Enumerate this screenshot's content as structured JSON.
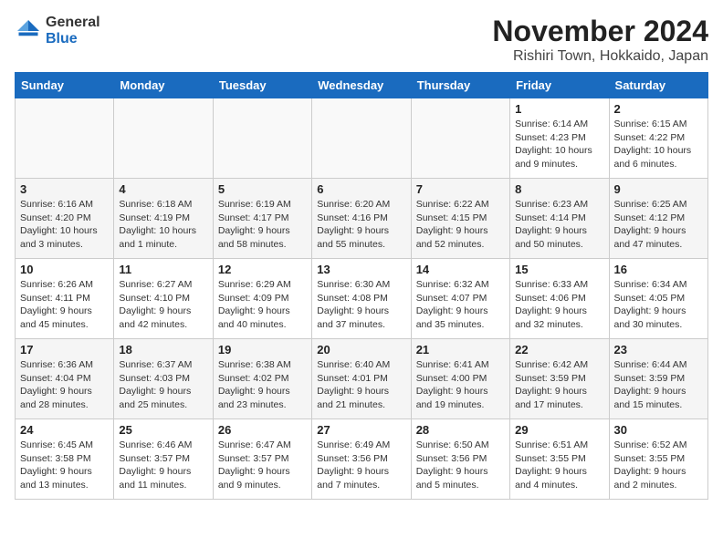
{
  "logo": {
    "general": "General",
    "blue": "Blue"
  },
  "header": {
    "month": "November 2024",
    "location": "Rishiri Town, Hokkaido, Japan"
  },
  "weekdays": [
    "Sunday",
    "Monday",
    "Tuesday",
    "Wednesday",
    "Thursday",
    "Friday",
    "Saturday"
  ],
  "weeks": [
    [
      {
        "day": "",
        "info": ""
      },
      {
        "day": "",
        "info": ""
      },
      {
        "day": "",
        "info": ""
      },
      {
        "day": "",
        "info": ""
      },
      {
        "day": "",
        "info": ""
      },
      {
        "day": "1",
        "info": "Sunrise: 6:14 AM\nSunset: 4:23 PM\nDaylight: 10 hours\nand 9 minutes."
      },
      {
        "day": "2",
        "info": "Sunrise: 6:15 AM\nSunset: 4:22 PM\nDaylight: 10 hours\nand 6 minutes."
      }
    ],
    [
      {
        "day": "3",
        "info": "Sunrise: 6:16 AM\nSunset: 4:20 PM\nDaylight: 10 hours\nand 3 minutes."
      },
      {
        "day": "4",
        "info": "Sunrise: 6:18 AM\nSunset: 4:19 PM\nDaylight: 10 hours\nand 1 minute."
      },
      {
        "day": "5",
        "info": "Sunrise: 6:19 AM\nSunset: 4:17 PM\nDaylight: 9 hours\nand 58 minutes."
      },
      {
        "day": "6",
        "info": "Sunrise: 6:20 AM\nSunset: 4:16 PM\nDaylight: 9 hours\nand 55 minutes."
      },
      {
        "day": "7",
        "info": "Sunrise: 6:22 AM\nSunset: 4:15 PM\nDaylight: 9 hours\nand 52 minutes."
      },
      {
        "day": "8",
        "info": "Sunrise: 6:23 AM\nSunset: 4:14 PM\nDaylight: 9 hours\nand 50 minutes."
      },
      {
        "day": "9",
        "info": "Sunrise: 6:25 AM\nSunset: 4:12 PM\nDaylight: 9 hours\nand 47 minutes."
      }
    ],
    [
      {
        "day": "10",
        "info": "Sunrise: 6:26 AM\nSunset: 4:11 PM\nDaylight: 9 hours\nand 45 minutes."
      },
      {
        "day": "11",
        "info": "Sunrise: 6:27 AM\nSunset: 4:10 PM\nDaylight: 9 hours\nand 42 minutes."
      },
      {
        "day": "12",
        "info": "Sunrise: 6:29 AM\nSunset: 4:09 PM\nDaylight: 9 hours\nand 40 minutes."
      },
      {
        "day": "13",
        "info": "Sunrise: 6:30 AM\nSunset: 4:08 PM\nDaylight: 9 hours\nand 37 minutes."
      },
      {
        "day": "14",
        "info": "Sunrise: 6:32 AM\nSunset: 4:07 PM\nDaylight: 9 hours\nand 35 minutes."
      },
      {
        "day": "15",
        "info": "Sunrise: 6:33 AM\nSunset: 4:06 PM\nDaylight: 9 hours\nand 32 minutes."
      },
      {
        "day": "16",
        "info": "Sunrise: 6:34 AM\nSunset: 4:05 PM\nDaylight: 9 hours\nand 30 minutes."
      }
    ],
    [
      {
        "day": "17",
        "info": "Sunrise: 6:36 AM\nSunset: 4:04 PM\nDaylight: 9 hours\nand 28 minutes."
      },
      {
        "day": "18",
        "info": "Sunrise: 6:37 AM\nSunset: 4:03 PM\nDaylight: 9 hours\nand 25 minutes."
      },
      {
        "day": "19",
        "info": "Sunrise: 6:38 AM\nSunset: 4:02 PM\nDaylight: 9 hours\nand 23 minutes."
      },
      {
        "day": "20",
        "info": "Sunrise: 6:40 AM\nSunset: 4:01 PM\nDaylight: 9 hours\nand 21 minutes."
      },
      {
        "day": "21",
        "info": "Sunrise: 6:41 AM\nSunset: 4:00 PM\nDaylight: 9 hours\nand 19 minutes."
      },
      {
        "day": "22",
        "info": "Sunrise: 6:42 AM\nSunset: 3:59 PM\nDaylight: 9 hours\nand 17 minutes."
      },
      {
        "day": "23",
        "info": "Sunrise: 6:44 AM\nSunset: 3:59 PM\nDaylight: 9 hours\nand 15 minutes."
      }
    ],
    [
      {
        "day": "24",
        "info": "Sunrise: 6:45 AM\nSunset: 3:58 PM\nDaylight: 9 hours\nand 13 minutes."
      },
      {
        "day": "25",
        "info": "Sunrise: 6:46 AM\nSunset: 3:57 PM\nDaylight: 9 hours\nand 11 minutes."
      },
      {
        "day": "26",
        "info": "Sunrise: 6:47 AM\nSunset: 3:57 PM\nDaylight: 9 hours\nand 9 minutes."
      },
      {
        "day": "27",
        "info": "Sunrise: 6:49 AM\nSunset: 3:56 PM\nDaylight: 9 hours\nand 7 minutes."
      },
      {
        "day": "28",
        "info": "Sunrise: 6:50 AM\nSunset: 3:56 PM\nDaylight: 9 hours\nand 5 minutes."
      },
      {
        "day": "29",
        "info": "Sunrise: 6:51 AM\nSunset: 3:55 PM\nDaylight: 9 hours\nand 4 minutes."
      },
      {
        "day": "30",
        "info": "Sunrise: 6:52 AM\nSunset: 3:55 PM\nDaylight: 9 hours\nand 2 minutes."
      }
    ]
  ]
}
